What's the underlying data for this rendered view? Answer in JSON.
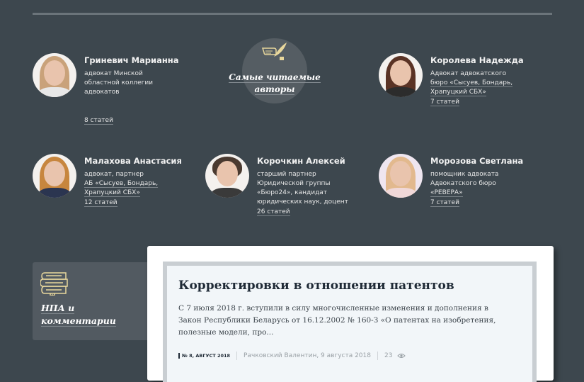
{
  "section": {
    "title_line1": "Самые читаемые",
    "title_line2": "авторы"
  },
  "authors": [
    {
      "name": "Гриневич Марианна",
      "desc": [
        "адвокат Минской",
        "областной коллегии",
        "адвокатов"
      ],
      "count": "8 статей"
    },
    {
      "name": "Королева Надежда",
      "desc": [
        "Адвокат адвокатского",
        "бюро «Сысуев, Бондарь,",
        "Храпуцкий СБХ»"
      ],
      "count": "7 статей"
    },
    {
      "name": "Малахова Анастасия",
      "desc": [
        "адвокат, партнер",
        "АБ «Сысуев, Бондарь,",
        "Храпуцкий СБХ»"
      ],
      "count": "12 статей"
    },
    {
      "name": "Корочкин Алексей",
      "desc": [
        "старший партнер",
        "Юридической группы",
        "«Бюро24», кандидат",
        "юридических наук, доцент"
      ],
      "count": "26 статей"
    },
    {
      "name": "Морозова Светлана",
      "desc": [
        "помощник адвоката",
        "Адвокатского бюро",
        "«РЕВЕРА»"
      ],
      "count": "7 статей"
    }
  ],
  "npa": {
    "line1": "НПА и",
    "line2": "комментарии"
  },
  "article": {
    "title": "Корректировки в отношении патентов",
    "text": "С 7 июля 2018 г. вступили в силу многочисленные изменения и дополнения в Закон Республики Беларусь от 16.12.2002 № 160-З «О патентах на изобретения, полезные модели, про...",
    "issue": "№ 8, АВГУСТ 2018",
    "byline": "Рачковский Валентин, 9 августа 2018",
    "views": "23"
  }
}
